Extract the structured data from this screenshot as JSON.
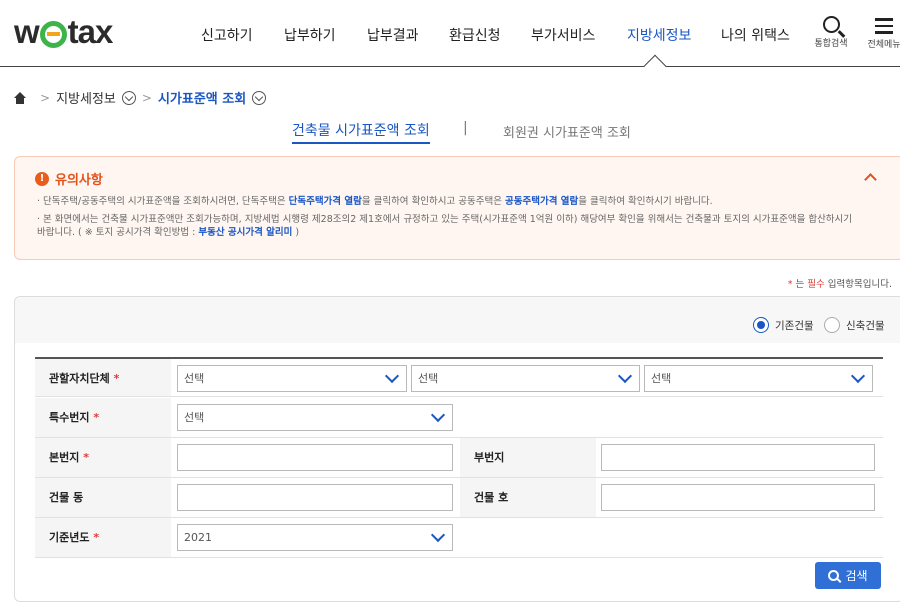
{
  "header": {
    "logo_text": "wetax",
    "nav": [
      "신고하기",
      "납부하기",
      "납부결과",
      "환급신청",
      "부가서비스",
      "지방세정보",
      "나의 위택스"
    ],
    "active_nav": "지방세정보",
    "search_label": "통합검색",
    "menu_label": "전체메뉴"
  },
  "breadcrumb": {
    "level1": "지방세정보",
    "current": "시가표준액 조회"
  },
  "subtabs": {
    "active": "건축물 시가표준액 조회",
    "separator": "|",
    "inactive": "회원권 시가표준액 조회"
  },
  "notice": {
    "title": "유의사항",
    "line1_a": "· 단독주택/공동주택의 시가표준액을 조회하시려면, 단독주택은 ",
    "line1_link1": "단독주택가격 열람",
    "line1_b": "을 클릭하여 확인하시고 공동주택은 ",
    "line1_link2": "공동주택가격 열람",
    "line1_c": "을 클릭하여 확인하시기 바랍니다.",
    "line2": "· 본 화면에서는 건축물 시가표준액만 조회가능하며, 지방세법 시행령 제28조의2 제1호에서 규정하고 있는 주택(시가표준액 1억원 이하) 해당여부 확인을 위해서는 건축물과 토지의 시가표준액을 합산하시기",
    "line3_a": "바랍니다. ( ※ 토지 공시가격 확인방법 : ",
    "line3_link": "부동산 공시가격 알리미",
    "line3_b": " )"
  },
  "required_note": {
    "star": "*",
    "a": " 는 ",
    "req": "필수",
    "b": " 입력항목입니다."
  },
  "form": {
    "radio_existing": "기존건물",
    "radio_new": "신축건물",
    "required_star": "*",
    "jurisdiction_label": "관할자치단체",
    "special_lot_label": "특수번지",
    "main_lot_label": "본번지",
    "sub_lot_label": "부번지",
    "building_dong_label": "건물 동",
    "building_ho_label": "건물 호",
    "base_year_label": "기준년도",
    "select_placeholder_1": "선택",
    "select_placeholder_2": "선택",
    "select_placeholder_3": "선택",
    "special_lot_value": "선택",
    "base_year_value": "2021",
    "search_button": "검색"
  }
}
